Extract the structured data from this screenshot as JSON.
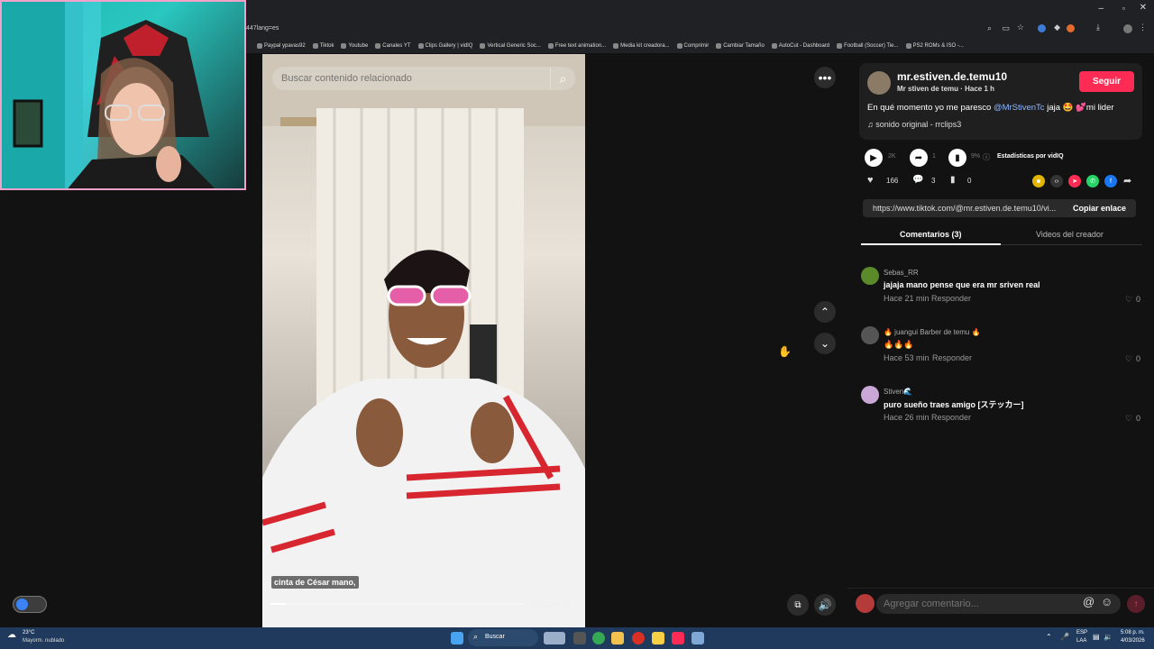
{
  "browser": {
    "address": "447lang=es",
    "bookmarks": [
      "Paypal ypavas92",
      "Tiktok",
      "Youtube",
      "Canales YT",
      "Clips Gallery | vidIQ",
      "Vertical Generic Soc...",
      "Free text animation...",
      "Media kit creadora...",
      "Comprimir",
      "Cambiar Tamaño",
      "AutoCut - Dashboard",
      "Football (Soccer) Tie...",
      "PS2 ROMs & ISO -..."
    ]
  },
  "video": {
    "search_placeholder": "Buscar contenido relacionado",
    "caption": "cinta de César mano,",
    "time": "00:00/00:15",
    "progress_fraction": 0.06
  },
  "author": {
    "username": "mr.estiven.de.temu10",
    "subtitle": "Mr stiven de temu · Hace 1 h",
    "follow_label": "Seguir",
    "description_prefix": "En qué momento yo me paresco ",
    "mention": "@MrStivenTc",
    "description_suffix": " jaja 🤩 💕mi lider",
    "sound": "sonido original - rrclips3"
  },
  "stats": {
    "plays": "2K",
    "shares": "1",
    "percent": "9%",
    "vidiq_label": "Estadísticas por vidIQ",
    "likes": "166",
    "comments": "3",
    "saves": "0"
  },
  "link": {
    "url": "https://www.tiktok.com/@mr.estiven.de.temu10/vi...",
    "copy_label": "Copiar enlace"
  },
  "tabs": {
    "comments": "Comentarios (3)",
    "creator_videos": "Videos del creador"
  },
  "comments": [
    {
      "name": "Sebas_RR",
      "text": "jajaja mano pense que era mr sriven real",
      "time": "Hace 21 min",
      "reply": "Responder",
      "likes": "0"
    },
    {
      "name": "🔥 juangui Barber de temu 🔥",
      "text": "🔥🔥🔥",
      "time": "Hace 53 min",
      "reply": "Responder",
      "likes": "0"
    },
    {
      "name": "Stiven🌊",
      "text": "puro sueño traes amigo [ステッカー]",
      "time": "Hace 26 min",
      "reply": "Responder",
      "likes": "0"
    }
  ],
  "comment_box": {
    "placeholder": "Agregar comentario..."
  },
  "taskbar": {
    "temp": "23°C",
    "weather": "Mayorm. nublado",
    "search_label": "Buscar",
    "lang1": "ESP",
    "lang2": "LAA",
    "clock_time": "5:08 p. m.",
    "clock_date": "4/03/2026"
  },
  "colors": {
    "accent": "#fe2c55",
    "mention": "#8fb8ff",
    "taskbar": "#1f3a5c"
  }
}
